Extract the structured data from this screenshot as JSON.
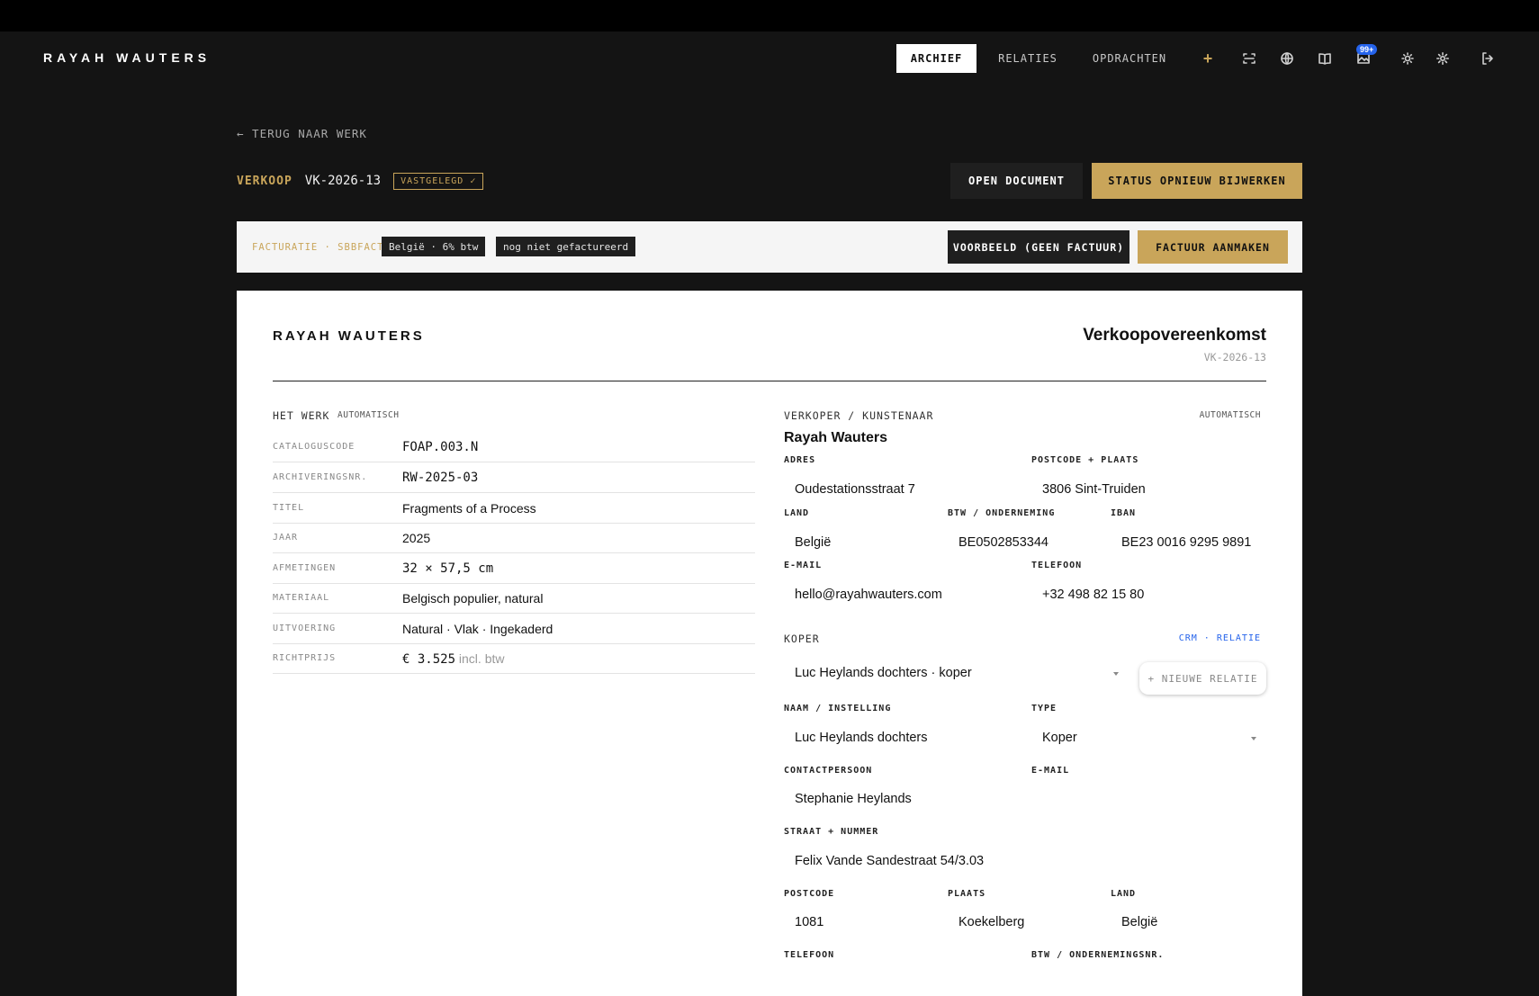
{
  "app": {
    "brand": "RAYAH WAUTERS"
  },
  "nav": {
    "items": [
      {
        "label": "ARCHIEF",
        "active": true
      },
      {
        "label": "RELATIES",
        "active": false
      },
      {
        "label": "OPDRACHTEN",
        "active": false
      }
    ],
    "add_label": "+",
    "notification_badge": "99+",
    "icons": [
      "scan-icon",
      "globe-icon",
      "book-icon",
      "image-icon",
      "sun-icon",
      "gear-icon",
      "logout-icon"
    ]
  },
  "back_link": "← TERUG NAAR WERK",
  "record": {
    "kind": "VERKOOP",
    "id": "VK-2026-13",
    "status_badge": "VASTGELEGD ✓"
  },
  "actions": {
    "open_document": "OPEN DOCUMENT",
    "refresh_status": "STATUS OPNIEUW BIJWERKEN"
  },
  "invoice_bar": {
    "label": "FACTURATIE · SBBFACT",
    "chip_vat": "België · 6% btw",
    "chip_status": "nog niet gefactureerd",
    "preview_button": "VOORBEELD (GEEN FACTUUR)",
    "create_button": "FACTUUR AANMAKEN"
  },
  "document": {
    "brand": "RAYAH WAUTERS",
    "title": "Verkoopovereenkomst",
    "reference": "VK-2026-13",
    "work": {
      "heading": "HET WERK",
      "tag": "AUTOMATISCH",
      "rows": [
        {
          "label": "CATALOGUSCODE",
          "value": "FOAP.003.N"
        },
        {
          "label": "ARCHIVERINGSNR.",
          "value": "RW-2025-03"
        },
        {
          "label": "TITEL",
          "value": "Fragments of a Process"
        },
        {
          "label": "JAAR",
          "value": "2025"
        },
        {
          "label": "AFMETINGEN",
          "value": "32 × 57,5 cm"
        },
        {
          "label": "MATERIAAL",
          "value": "Belgisch populier, natural"
        },
        {
          "label": "UITVOERING",
          "value": "Natural · Vlak · Ingekaderd"
        },
        {
          "label": "RICHTPRIJS",
          "value": "€ 3.525",
          "suffix": "incl. btw"
        }
      ]
    },
    "seller": {
      "heading": "VERKOPER / KUNSTENAAR",
      "tag": "AUTOMATISCH",
      "name": "Rayah Wauters",
      "address_label": "ADRES",
      "address": "Oudestationsstraat 7",
      "postcode_city_label": "POSTCODE + PLAATS",
      "postcode_city": "3806 Sint-Truiden",
      "country_label": "LAND",
      "country": "België",
      "vat_label": "BTW / ONDERNEMING",
      "vat": "BE0502853344",
      "iban_label": "IBAN",
      "iban": "BE23 0016 9295 9891",
      "email_label": "E-MAIL",
      "email": "hello@rayahwauters.com",
      "phone_label": "TELEFOON",
      "phone": "+32 498 82 15 80"
    },
    "buyer": {
      "heading": "KOPER",
      "crm_link": "CRM · RELATIE",
      "selected_relation": "Luc Heylands dochters · koper",
      "new_relation_button": "+ NIEUWE RELATIE",
      "name_label": "NAAM / INSTELLING",
      "name": "Luc Heylands dochters",
      "type_label": "TYPE",
      "type": "Koper",
      "contact_label": "CONTACTPERSOON",
      "contact": "Stephanie Heylands",
      "email_label": "E-MAIL",
      "email": "",
      "street_label": "STRAAT + NUMMER",
      "street": "Felix Vande Sandestraat 54/3.03",
      "postcode_label": "POSTCODE",
      "postcode": "1081",
      "city_label": "PLAATS",
      "city": "Koekelberg",
      "country_label": "LAND",
      "country": "België",
      "phone_label": "TELEFOON",
      "vat_label": "BTW / ONDERNEMINGSNR."
    }
  }
}
